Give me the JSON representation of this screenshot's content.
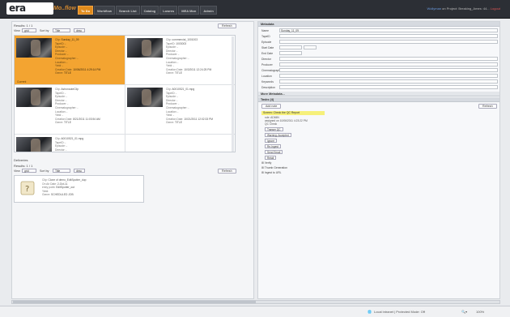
{
  "app": {
    "logo": "era",
    "logo_sub": "Mo..flow"
  },
  "nav": {
    "tabs": [
      "To Do",
      "Workflow",
      "Search List",
      "Catalog",
      "Lowres",
      "MEA Mon",
      "Admin"
    ],
    "active_index": 0
  },
  "user": {
    "prefix": "",
    "link": "Wollyman",
    "project": "on Project: Breaking_Ames: 44...",
    "logout": "Logout"
  },
  "results": {
    "title": "Results: 1 / 1",
    "view_label": "View",
    "view_value": "grid",
    "sort_label": "Sort by",
    "sort_value": "Title",
    "dir_value": "desc",
    "refresh": "Refresh",
    "cards": [
      {
        "clip": "Sunday_11_09",
        "tape": "-",
        "episode": "-",
        "director": "-",
        "producer": "-",
        "cinematographer": "-",
        "location": "-",
        "yield": "-",
        "created": "10/06/2011 4:29:14 PM",
        "genre": "TITLE",
        "status": "Current",
        "selected": true
      },
      {
        "clip": "commercial_1001003",
        "tape": "1003003",
        "episode": "-",
        "director": "-",
        "producer": "-",
        "cinematographer": "-",
        "location": "-",
        "yield": "-",
        "created": "10/3/2011 12:24:25 PM",
        "genre": "TITLE",
        "status": "",
        "selected": false
      },
      {
        "clip": "AstronauteClip",
        "tape": "-",
        "episode": "-",
        "director": "-",
        "producer": "-",
        "cinematographer": "-",
        "location": "-",
        "yield": "-",
        "created": "8/21/2011 11:03:54 AM",
        "genre": "TITLE",
        "status": "",
        "selected": false
      },
      {
        "clip": "A0010521_01.mpg",
        "tape": "-",
        "episode": "-",
        "director": "-",
        "producer": "-",
        "cinematographer": "-",
        "location": "-",
        "yield": "-",
        "created": "10/21/2011 12:02:33 PM",
        "genre": "TITLE",
        "status": "",
        "selected": false
      },
      {
        "clip": "A0010521_01.mpg",
        "tape": "-",
        "episode": "-",
        "director": "-",
        "producer": "-",
        "cinematographer": "-",
        "location": "-",
        "yield": "-",
        "created": "",
        "genre": "",
        "status": "",
        "selected": false
      }
    ]
  },
  "deliveries": {
    "title": "Deliveries",
    "results": "Results: 1 / 1",
    "view_value": "grid",
    "sort_value": "Title",
    "dir_value": "desc",
    "refresh": "Refresh",
    "item": {
      "clip": "Clone of demo_EditSpotter_dup",
      "on_air": "2-Oct-11",
      "entry_point": "EditSpotter_out",
      "yield": "",
      "genre": "SCHEDULED JOB"
    }
  },
  "metadata": {
    "title": "Metadata",
    "fields": [
      {
        "label": "Name",
        "value": "Sunday_11_09"
      },
      {
        "label": "TapeID",
        "value": ""
      },
      {
        "label": "Episode",
        "value": ""
      },
      {
        "label": "Start Date",
        "value": ""
      },
      {
        "label": "End Date",
        "value": ""
      },
      {
        "label": "Director",
        "value": ""
      },
      {
        "label": "Producer",
        "value": ""
      },
      {
        "label": "Cinematographer",
        "value": ""
      },
      {
        "label": "Location",
        "value": ""
      },
      {
        "label": "Keywords",
        "value": ""
      },
      {
        "label": "Description",
        "value": ""
      }
    ],
    "more": "More Metadata..."
  },
  "tasks": {
    "title": "Tasks (4)",
    "add_note": "Add note",
    "refresh": "Refresh",
    "highlight": "Screen: Check the QC Report",
    "lines": [
      "role: ADMIN",
      "assigned on 10/06/2011 4:23:22 PM",
      "QC Check"
    ],
    "buttons": [
      "Transer QC",
      "Warning: Accepted",
      "Ignore",
      "Re-Ingest",
      "Send Email",
      "Retail"
    ],
    "tree": [
      "Verify",
      "Thumb Generation",
      "Ingest to URL"
    ]
  },
  "statusbar": {
    "zone": "Local intranet | Protected Mode: Off",
    "zoom": "100%"
  }
}
